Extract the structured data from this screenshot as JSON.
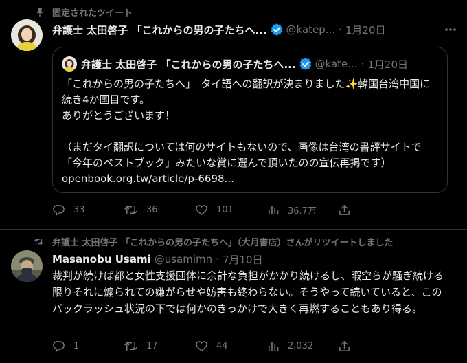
{
  "colors": {
    "background": "#000000",
    "text_primary": "#e7e9ea",
    "text_secondary": "#71767b",
    "verified": "#1d9bf0",
    "border": "#2f3336"
  },
  "tweet1": {
    "context": "固定されたツイート",
    "display_name": "弁護士 太田啓子 「これからの男の子たちへ...",
    "handle": "@katep...",
    "separator": "·",
    "date": "1月20日",
    "quote": {
      "display_name": "弁護士 太田啓子 「これからの男の子たちへ...",
      "handle": "@kate...",
      "separator": "·",
      "date": "1月20日",
      "body_line1": "「これからの男の子たちへ」　タイ語への翻訳が決まりました✨韓国台湾中国に続き4か国目です。",
      "body_line2": "ありがとうございます！",
      "body_line3": "（まだタイ翻訳については何のサイトもないので、画像は台湾の書評サイトで「今年のベストブック」みたいな賞に選んで頂いたのの宣伝再掲です）",
      "link": "openbook.org.tw/article/p-6698..."
    },
    "actions": {
      "replies": "33",
      "retweets": "36",
      "likes": "101",
      "views": "36.7万"
    }
  },
  "tweet2": {
    "context": "弁護士 太田啓子 「これからの男の子たちへ」（大月書店）さんがリツイートしました",
    "display_name": "Masanobu Usami",
    "handle": "@usamimn",
    "separator": "·",
    "date": "7月10日",
    "body": "裁判が続けば都と女性支援団体に余計な負担がかかり続けるし、暇空らが騒ぎ続ける限りそれに煽られての嫌がらせや妨害も終わらない。そうやって続いていると、このバックラッシュ状況の下では何かのきっかけで大きく再燃することもあり得る。",
    "actions": {
      "replies": "1",
      "retweets": "17",
      "likes": "44",
      "views": "2,032"
    }
  }
}
